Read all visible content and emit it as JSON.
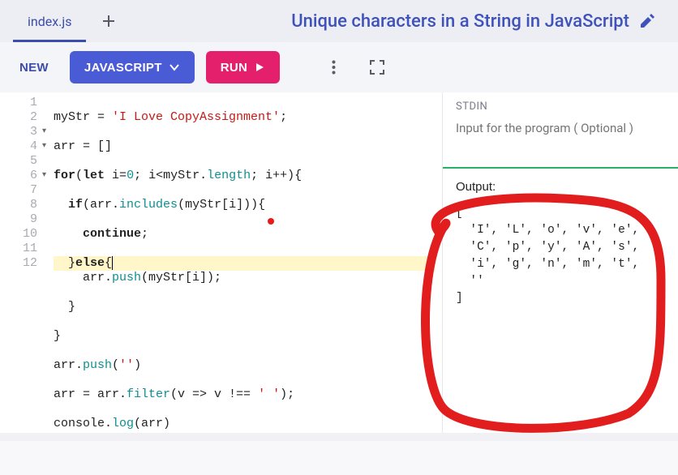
{
  "tabs": {
    "active_label": "index.js"
  },
  "title": "Unique characters in a String in JavaScript",
  "toolbar": {
    "new_label": "NEW",
    "lang_label": "JAVASCRIPT",
    "run_label": "RUN"
  },
  "editor": {
    "lines": [
      "1",
      "2",
      "3",
      "4",
      "5",
      "6",
      "7",
      "8",
      "9",
      "10",
      "11",
      "12"
    ],
    "fold_lines": [
      3,
      4,
      6
    ],
    "code": {
      "l1_a": "myStr = ",
      "l1_b": "'I Love CopyAssignment'",
      "l1_c": ";",
      "l2": "arr = []",
      "l3_a": "for",
      "l3_b": "(",
      "l3_c": "let",
      "l3_d": " i=",
      "l3_e": "0",
      "l3_f": "; i<myStr.",
      "l3_g": "length",
      "l3_h": "; i++){",
      "l4_a": "  ",
      "l4_b": "if",
      "l4_c": "(arr.",
      "l4_d": "includes",
      "l4_e": "(myStr[i])){",
      "l5_a": "    ",
      "l5_b": "continue",
      "l5_c": ";",
      "l6_a": "  }",
      "l6_b": "else",
      "l6_c": "{",
      "l7_a": "    arr.",
      "l7_b": "push",
      "l7_c": "(myStr[i]);",
      "l8": "  }",
      "l9": "}",
      "l10_a": "arr.",
      "l10_b": "push",
      "l10_c": "(",
      "l10_d": "''",
      "l10_e": ")",
      "l11_a": "arr = arr.",
      "l11_b": "filter",
      "l11_c": "(v => v !== ",
      "l11_d": "' '",
      "l11_e": ");",
      "l12_a": "console.",
      "l12_b": "log",
      "l12_c": "(arr)"
    }
  },
  "stdin": {
    "label": "STDIN",
    "placeholder": "Input for the program ( Optional )"
  },
  "output": {
    "label": "Output:",
    "body": "[\n  'I', 'L', 'o', 'v', 'e',\n  'C', 'p', 'y', 'A', 's',\n  'i', 'g', 'n', 'm', 't',\n  ''\n]"
  }
}
